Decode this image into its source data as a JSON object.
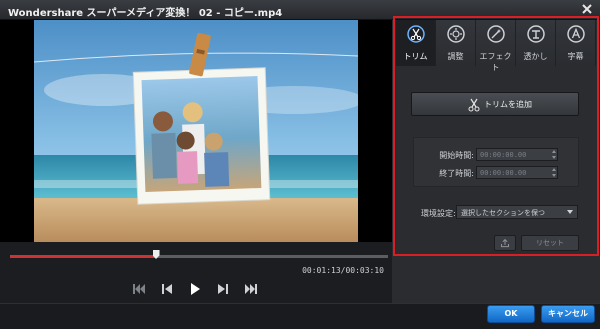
{
  "window": {
    "title": "Wondershare スーパーメディア変換！ 02 - コピー.mp4"
  },
  "player": {
    "timecode": "00:01:13/00:03:10",
    "progress_fraction": 0.385
  },
  "tabs": [
    {
      "label": "トリム",
      "icon": "scissors-icon",
      "active": true
    },
    {
      "label": "調整",
      "icon": "sun-icon",
      "active": false
    },
    {
      "label": "エフェクト",
      "icon": "magic-wand-icon",
      "active": false
    },
    {
      "label": "透かし",
      "icon": "watermark-icon",
      "active": false
    },
    {
      "label": "字幕",
      "icon": "letter-a-icon",
      "active": false
    }
  ],
  "trim": {
    "add_label": "トリムを追加",
    "start_label": "開始時間:",
    "start_value": "00:00:00.00",
    "end_label": "終了時間:",
    "end_value": "00:00:00.00"
  },
  "environment": {
    "label": "環境設定:",
    "selected": "選択したセクションを保つ"
  },
  "actions": {
    "reset_label": "リセット"
  },
  "footer": {
    "ok_label": "OK",
    "cancel_label": "キャンセル"
  },
  "colors": {
    "highlight_border": "#d91f26",
    "primary_button": "#1f7fd8",
    "active_icon": "#6fb4ff"
  }
}
